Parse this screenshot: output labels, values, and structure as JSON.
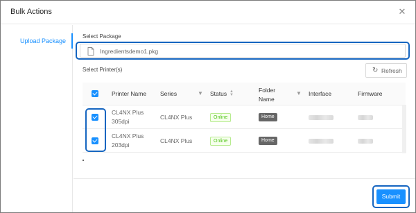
{
  "dialog": {
    "title": "Bulk Actions",
    "close_icon": "close-icon"
  },
  "sidenav": {
    "items": [
      {
        "label": "Upload Package"
      }
    ]
  },
  "package": {
    "label": "Select Package",
    "value": "Ingredientsdemo1.pkg"
  },
  "printers": {
    "label": "Select Printer(s)",
    "refresh_label": "Refresh",
    "columns": [
      "Printer Name",
      "Series",
      "Status",
      "Folder Name",
      "Interface",
      "Firmware"
    ],
    "rows": [
      {
        "name_line1": "CL4NX Plus",
        "name_line2": "305dpi",
        "series": "CL4NX Plus",
        "status": "Online",
        "folder": "Home",
        "checked": true
      },
      {
        "name_line1": "CL4NX Plus",
        "name_line2": "203dpi",
        "series": "CL4NX Plus",
        "status": "Online",
        "folder": "Home",
        "checked": true
      }
    ]
  },
  "footer": {
    "submit_label": "Submit"
  },
  "colors": {
    "accent": "#1890ff",
    "callout": "#1565c0",
    "online": "#52c41a"
  }
}
